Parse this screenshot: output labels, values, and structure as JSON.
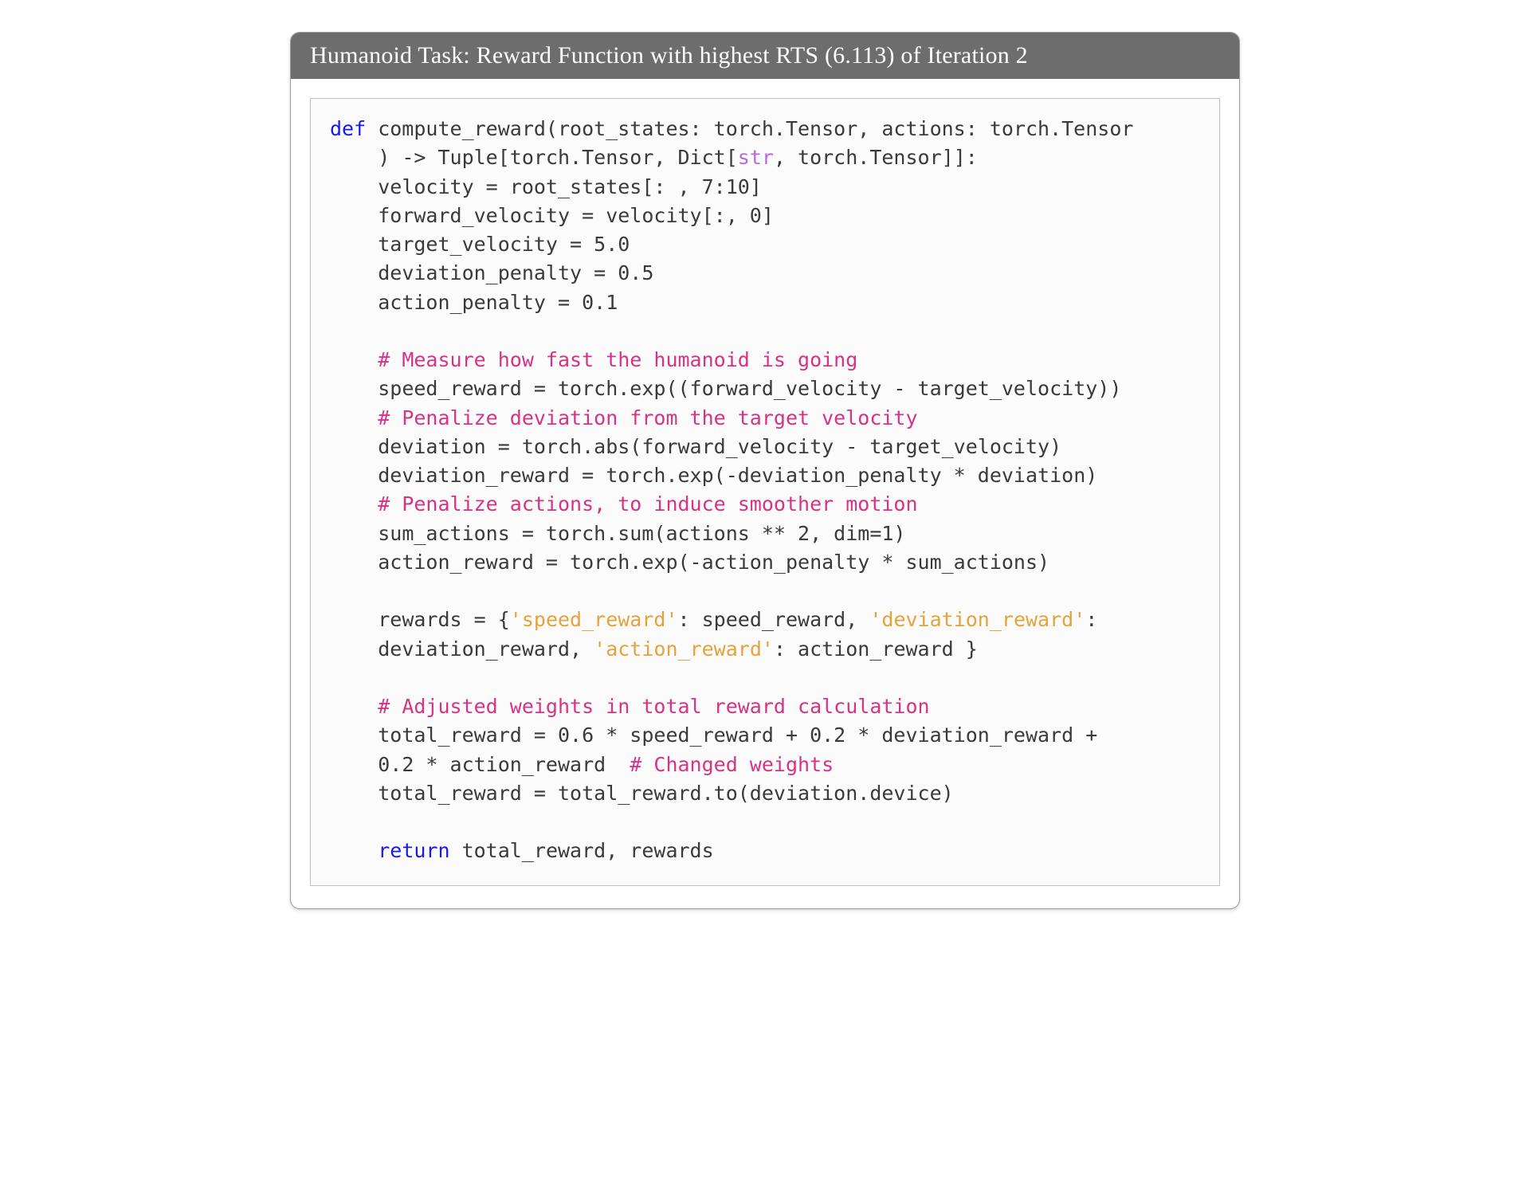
{
  "panel": {
    "title": "Humanoid Task: Reward Function with highest RTS (6.113) of Iteration 2"
  },
  "code": {
    "tokens": [
      {
        "cls": "tok-kw",
        "t": "def"
      },
      {
        "t": " compute_reward(root_states: torch.Tensor, actions: torch.Tensor\n    ) -> Tuple[torch.Tensor, Dict["
      },
      {
        "cls": "tok-type",
        "t": "str"
      },
      {
        "t": ", torch.Tensor]]:\n"
      },
      {
        "t": "    velocity = root_states[: , 7:10]\n"
      },
      {
        "t": "    forward_velocity = velocity[:, 0]\n"
      },
      {
        "t": "    target_velocity = 5.0\n"
      },
      {
        "t": "    deviation_penalty = 0.5\n"
      },
      {
        "t": "    action_penalty = 0.1\n"
      },
      {
        "t": "\n"
      },
      {
        "t": "    "
      },
      {
        "cls": "tok-cmt",
        "t": "# Measure how fast the humanoid is going"
      },
      {
        "t": "\n"
      },
      {
        "t": "    speed_reward = torch.exp((forward_velocity - target_velocity))\n"
      },
      {
        "t": "    "
      },
      {
        "cls": "tok-cmt",
        "t": "# Penalize deviation from the target velocity"
      },
      {
        "t": "\n"
      },
      {
        "t": "    deviation = torch.abs(forward_velocity - target_velocity)\n"
      },
      {
        "t": "    deviation_reward = torch.exp(-deviation_penalty * deviation)\n"
      },
      {
        "t": "    "
      },
      {
        "cls": "tok-cmt",
        "t": "# Penalize actions, to induce smoother motion"
      },
      {
        "t": "\n"
      },
      {
        "t": "    sum_actions = torch.sum(actions ** 2, dim=1)\n"
      },
      {
        "t": "    action_reward = torch.exp(-action_penalty * sum_actions)\n"
      },
      {
        "t": "\n"
      },
      {
        "t": "    rewards = {"
      },
      {
        "cls": "tok-str",
        "t": "'speed_reward'"
      },
      {
        "t": ": speed_reward, "
      },
      {
        "cls": "tok-str",
        "t": "'deviation_reward'"
      },
      {
        "t": ":\n"
      },
      {
        "t": "    deviation_reward, "
      },
      {
        "cls": "tok-str",
        "t": "'action_reward'"
      },
      {
        "t": ": action_reward }\n"
      },
      {
        "t": "\n"
      },
      {
        "t": "    "
      },
      {
        "cls": "tok-cmt",
        "t": "# Adjusted weights in total reward calculation"
      },
      {
        "t": "\n"
      },
      {
        "t": "    total_reward = 0.6 * speed_reward + 0.2 * deviation_reward +\n"
      },
      {
        "t": "    0.2 * action_reward  "
      },
      {
        "cls": "tok-cmt",
        "t": "# Changed weights"
      },
      {
        "t": "\n"
      },
      {
        "t": "    total_reward = total_reward.to(deviation.device)\n"
      },
      {
        "t": "\n"
      },
      {
        "t": "    "
      },
      {
        "cls": "tok-kw",
        "t": "return"
      },
      {
        "t": " total_reward, rewards"
      }
    ]
  }
}
